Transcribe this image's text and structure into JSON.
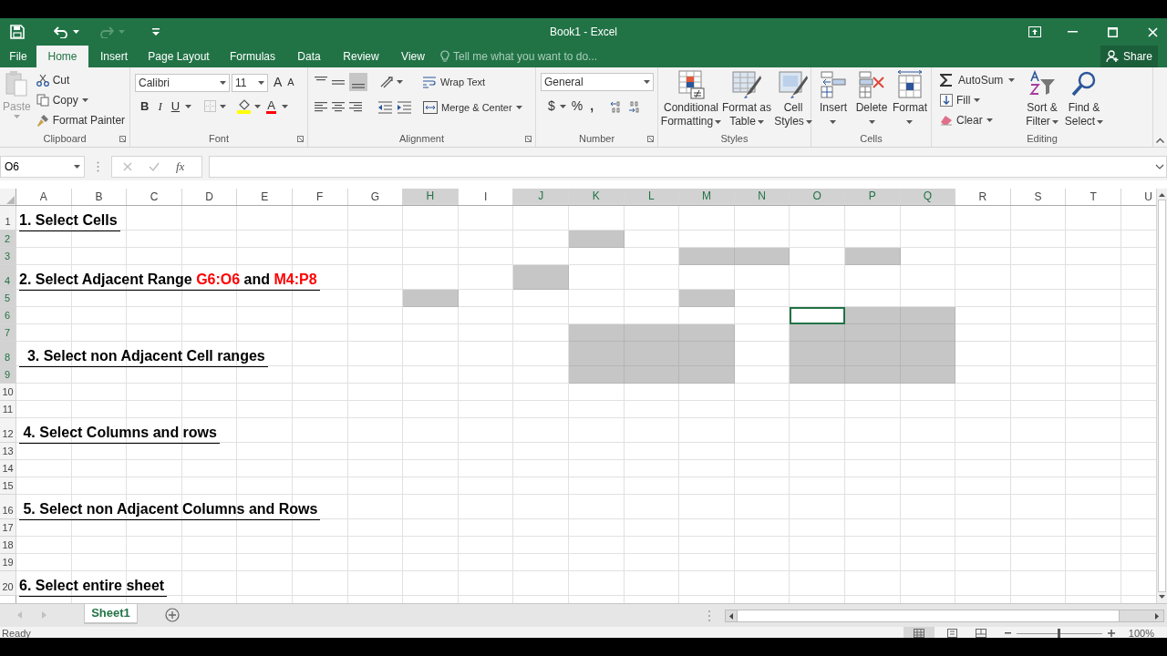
{
  "window": {
    "title": "Book1 - Excel"
  },
  "tabs": [
    {
      "label": "File",
      "selected": false
    },
    {
      "label": "Home",
      "selected": true
    },
    {
      "label": "Insert",
      "selected": false
    },
    {
      "label": "Page Layout",
      "selected": false
    },
    {
      "label": "Formulas",
      "selected": false
    },
    {
      "label": "Data",
      "selected": false
    },
    {
      "label": "Review",
      "selected": false
    },
    {
      "label": "View",
      "selected": false
    }
  ],
  "tell_me": {
    "placeholder": "Tell me what you want to do..."
  },
  "share": "Share",
  "ribbon": {
    "clipboard": {
      "label": "Clipboard",
      "paste": "Paste",
      "cut": "Cut",
      "copy": "Copy",
      "format_painter": "Format Painter"
    },
    "font": {
      "label": "Font",
      "font_name": "Calibri",
      "font_size": "11",
      "grow": "A",
      "shrink": "A",
      "bold": "B",
      "italic": "I",
      "underline": "U",
      "font_color": "A"
    },
    "alignment": {
      "label": "Alignment",
      "wrap_text": "Wrap Text",
      "merge": "Merge & Center"
    },
    "number": {
      "label": "Number",
      "format": "General",
      "currency": "$",
      "percent": "%",
      "comma": ","
    },
    "styles": {
      "label": "Styles",
      "buttons": [
        {
          "lines": [
            "Conditional",
            "Formatting"
          ]
        },
        {
          "lines": [
            "Format as",
            "Table"
          ]
        },
        {
          "lines": [
            "Cell",
            "Styles"
          ]
        }
      ]
    },
    "cells": {
      "label": "Cells",
      "buttons": [
        "Insert",
        "Delete",
        "Format"
      ]
    },
    "editing": {
      "label": "Editing",
      "autosum": "AutoSum",
      "fill": "Fill",
      "clear": "Clear",
      "sort": [
        "Sort &",
        "Filter"
      ],
      "find": [
        "Find &",
        "Select"
      ]
    }
  },
  "formula_bar": {
    "name_box": "O6",
    "fx": "fx"
  },
  "columns": [
    {
      "label": "A",
      "selected": false
    },
    {
      "label": "B",
      "selected": false
    },
    {
      "label": "C",
      "selected": false
    },
    {
      "label": "D",
      "selected": false
    },
    {
      "label": "E",
      "selected": false
    },
    {
      "label": "F",
      "selected": false
    },
    {
      "label": "G",
      "selected": false
    },
    {
      "label": "H",
      "selected": true
    },
    {
      "label": "I",
      "selected": false
    },
    {
      "label": "J",
      "selected": true
    },
    {
      "label": "K",
      "selected": true
    },
    {
      "label": "L",
      "selected": true
    },
    {
      "label": "M",
      "selected": true
    },
    {
      "label": "N",
      "selected": true
    },
    {
      "label": "O",
      "selected": true
    },
    {
      "label": "P",
      "selected": true
    },
    {
      "label": "Q",
      "selected": true
    },
    {
      "label": "R",
      "selected": false
    },
    {
      "label": "S",
      "selected": false
    },
    {
      "label": "T",
      "selected": false
    },
    {
      "label": "U",
      "selected": false
    }
  ],
  "rows": [
    {
      "label": "1",
      "selected": false,
      "heading": [
        {
          "text": "1. Select Cells",
          "color": "#000000"
        }
      ]
    },
    {
      "label": "2",
      "selected": true,
      "selected_cells": [
        false,
        false,
        false,
        false,
        false,
        false,
        false,
        false,
        false,
        false,
        true,
        false,
        false,
        false,
        false,
        false,
        false,
        false,
        false,
        false,
        false
      ]
    },
    {
      "label": "3",
      "selected": true,
      "selected_cells": [
        false,
        false,
        false,
        false,
        false,
        false,
        false,
        false,
        false,
        false,
        false,
        false,
        true,
        true,
        false,
        true,
        false,
        false,
        false,
        false,
        false
      ]
    },
    {
      "label": "4",
      "selected": true,
      "heading": [
        {
          "text": "2. Select Adjacent Range ",
          "color": "#000000"
        },
        {
          "text": "G6:O6",
          "color": "#ff0000"
        },
        {
          "text": " and ",
          "color": "#000000"
        },
        {
          "text": "M4:P8",
          "color": "#ff0000"
        }
      ],
      "selected_cells": [
        false,
        false,
        false,
        false,
        false,
        false,
        false,
        false,
        false,
        true,
        false,
        false,
        false,
        false,
        false,
        false,
        false,
        false,
        false,
        false,
        false
      ]
    },
    {
      "label": "5",
      "selected": true,
      "selected_cells": [
        false,
        false,
        false,
        false,
        false,
        false,
        false,
        true,
        false,
        false,
        false,
        false,
        true,
        false,
        false,
        false,
        false,
        false,
        false,
        false,
        false
      ]
    },
    {
      "label": "6",
      "selected": true,
      "selected_cells": [
        false,
        false,
        false,
        false,
        false,
        false,
        false,
        false,
        false,
        false,
        false,
        false,
        false,
        false,
        true,
        true,
        true,
        false,
        false,
        false,
        false
      ],
      "active_cells": [
        false,
        false,
        false,
        false,
        false,
        false,
        false,
        false,
        false,
        false,
        false,
        false,
        false,
        false,
        true,
        false,
        false,
        false,
        false,
        false,
        false
      ]
    },
    {
      "label": "7",
      "selected": true,
      "selected_cells": [
        false,
        false,
        false,
        false,
        false,
        false,
        false,
        false,
        false,
        false,
        true,
        true,
        true,
        false,
        true,
        true,
        true,
        false,
        false,
        false,
        false
      ]
    },
    {
      "label": "8",
      "selected": true,
      "heading": [
        {
          "text": "  3. Select non Adjacent Cell ranges",
          "color": "#000000"
        }
      ],
      "selected_cells": [
        false,
        false,
        false,
        false,
        false,
        false,
        false,
        false,
        false,
        false,
        true,
        true,
        true,
        false,
        true,
        true,
        true,
        false,
        false,
        false,
        false
      ]
    },
    {
      "label": "9",
      "selected": true,
      "selected_cells": [
        false,
        false,
        false,
        false,
        false,
        false,
        false,
        false,
        false,
        false,
        true,
        true,
        true,
        false,
        true,
        true,
        true,
        false,
        false,
        false,
        false
      ]
    },
    {
      "label": "10",
      "selected": false
    },
    {
      "label": "11",
      "selected": false
    },
    {
      "label": "12",
      "selected": false,
      "heading": [
        {
          "text": " 4. Select Columns and rows",
          "color": "#000000"
        }
      ]
    },
    {
      "label": "13",
      "selected": false
    },
    {
      "label": "14",
      "selected": false
    },
    {
      "label": "15",
      "selected": false
    },
    {
      "label": "16",
      "selected": false,
      "heading": [
        {
          "text": " 5. Select non Adjacent Columns and Rows",
          "color": "#000000"
        }
      ]
    },
    {
      "label": "17",
      "selected": false
    },
    {
      "label": "18",
      "selected": false
    },
    {
      "label": "19",
      "selected": false
    },
    {
      "label": "20",
      "selected": false,
      "heading": [
        {
          "text": "6. Select entire sheet",
          "color": "#000000"
        }
      ]
    }
  ],
  "sheets": [
    {
      "label": "Sheet1",
      "selected": true
    }
  ],
  "status_bar": {
    "status": "Ready",
    "zoom": "100%",
    "zoom_level": {
      "level": 0.5
    }
  }
}
